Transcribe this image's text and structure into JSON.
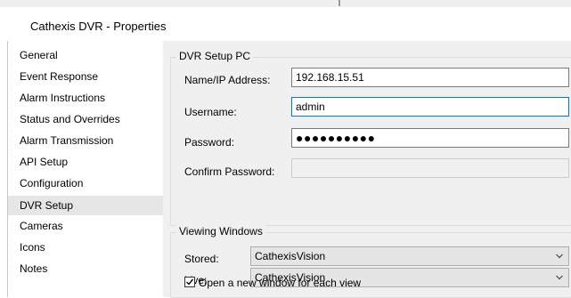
{
  "window": {
    "title": "Cathexis DVR - Properties"
  },
  "sidebar": {
    "items": [
      {
        "label": "General"
      },
      {
        "label": "Event Response"
      },
      {
        "label": "Alarm Instructions"
      },
      {
        "label": "Status and Overrides"
      },
      {
        "label": "Alarm Transmission"
      },
      {
        "label": "API Setup"
      },
      {
        "label": "Configuration"
      },
      {
        "label": "DVR Setup",
        "selected": true
      },
      {
        "label": "Cameras"
      },
      {
        "label": "Icons"
      },
      {
        "label": "Notes"
      }
    ]
  },
  "dvr_setup": {
    "group_title": "DVR Setup PC",
    "ip_label": "Name/IP Address:",
    "ip_value": "192.168.15.51",
    "username_label": "Username:",
    "username_value": "admin",
    "password_label": "Password:",
    "password_mask": "●●●●●●●●●●",
    "confirm_label": "Confirm Password:",
    "confirm_value": ""
  },
  "viewing": {
    "group_title": "Viewing Windows",
    "stored_label": "Stored:",
    "stored_value": "CathexisVision",
    "live_label": "Live:",
    "live_value": "CathexisVision",
    "new_window_label": "Open a new window for each view",
    "new_window_checked": true
  },
  "icons": {
    "dropdown": "chevron-down-icon",
    "check": "checkmark-icon"
  },
  "colors": {
    "focus_border": "#0078d7",
    "selected_nav": "#e6e6e6",
    "panel_bg": "#f0f0f0"
  }
}
